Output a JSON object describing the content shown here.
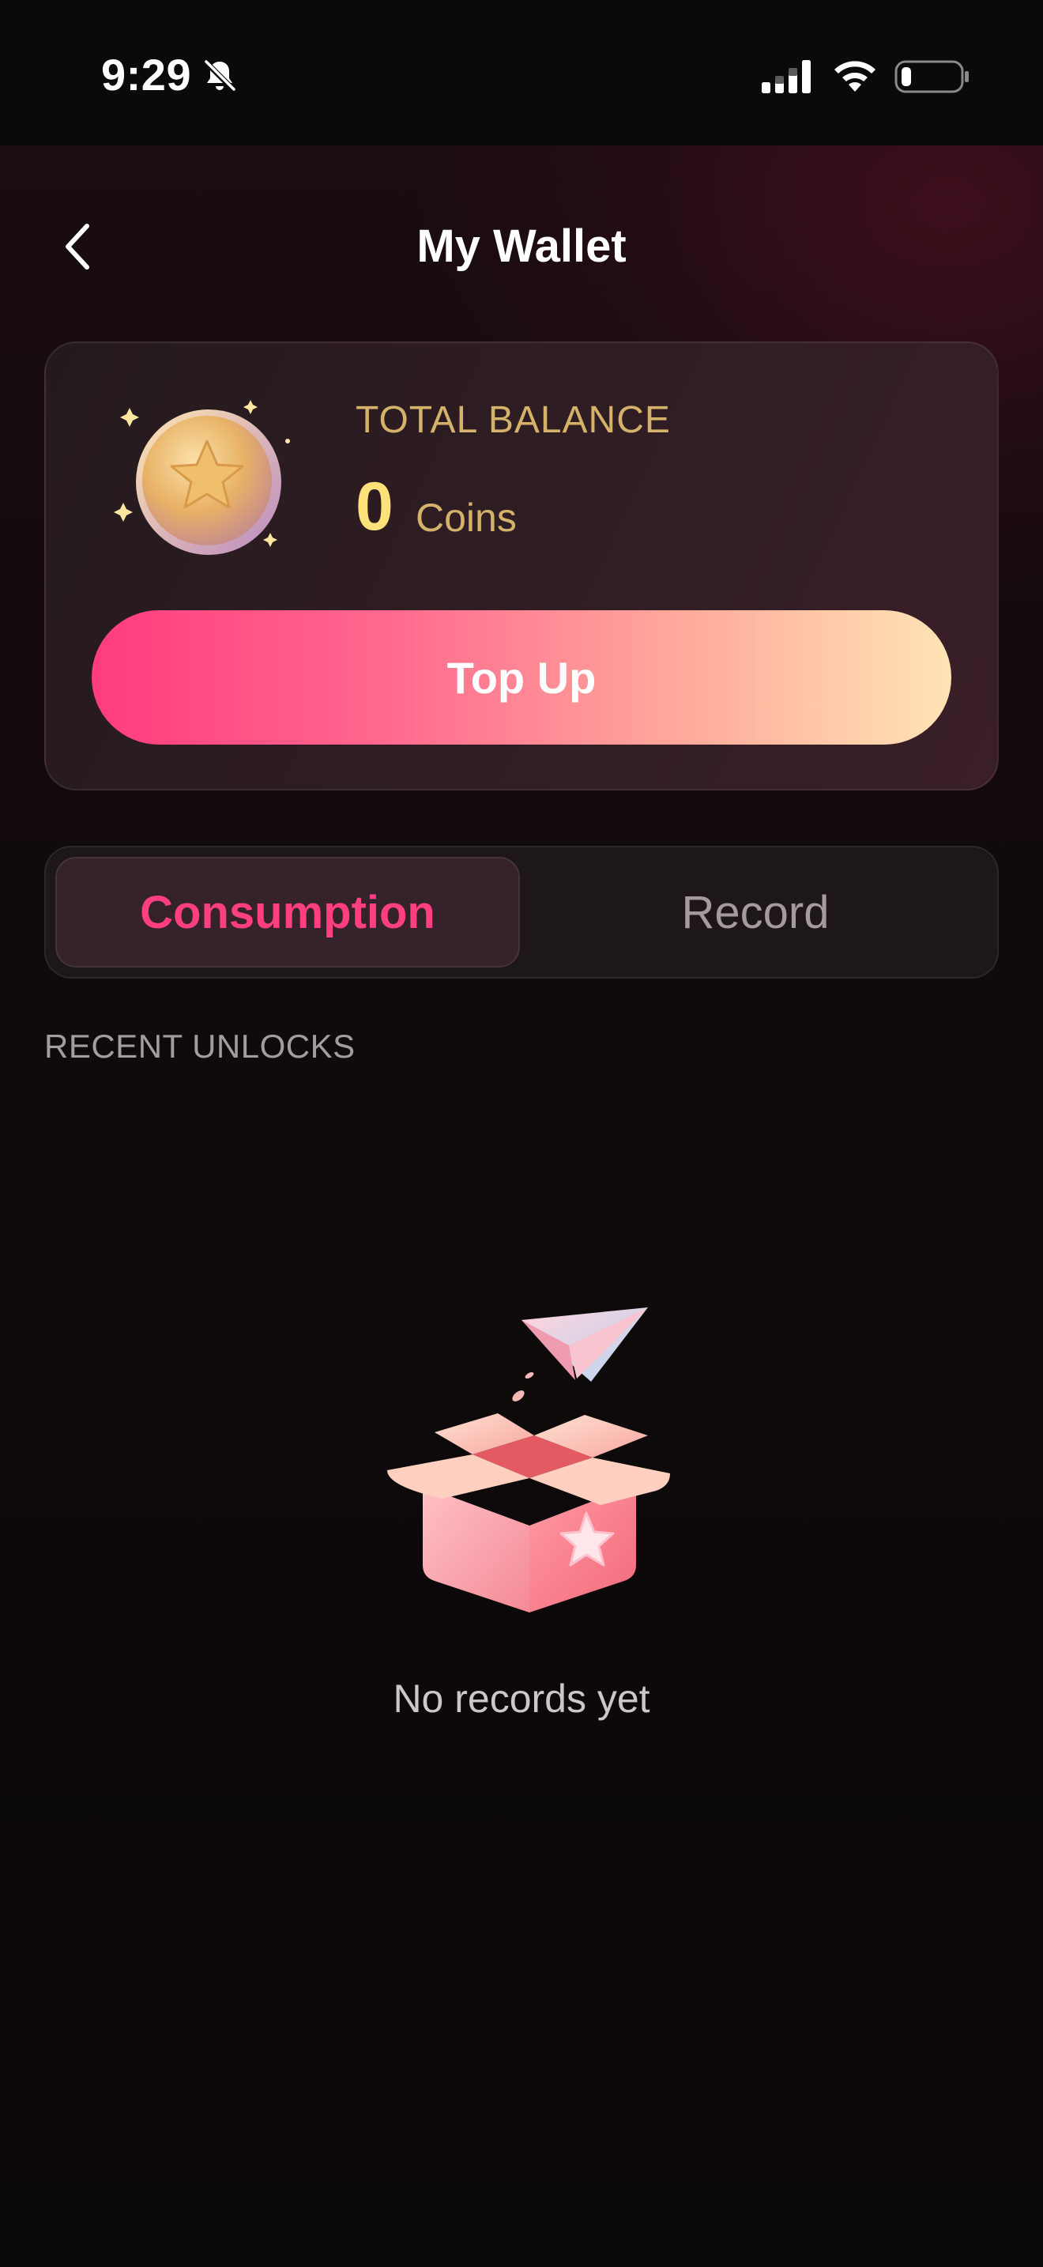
{
  "status_bar": {
    "time": "9:29",
    "icons": [
      "bell-slash-icon",
      "cellular-signal-icon",
      "wifi-icon",
      "battery-icon"
    ]
  },
  "header": {
    "title": "My Wallet",
    "back_icon": "chevron-left-icon"
  },
  "balance_card": {
    "coin_icon": "star-coin-icon",
    "label": "TOTAL BALANCE",
    "amount": "0",
    "unit": "Coins",
    "top_up_label": "Top Up"
  },
  "tabs": [
    {
      "label": "Consumption",
      "active": true
    },
    {
      "label": "Record",
      "active": false
    }
  ],
  "section": {
    "title": "RECENT UNLOCKS"
  },
  "empty_state": {
    "illustration_icon": "open-box-paper-plane-icon",
    "message": "No records yet"
  },
  "colors": {
    "accent": "#ff3f7f",
    "gold": "#d4b26a",
    "balance_value": "#ffe17a",
    "button_gradient_start": "#ff3c7e",
    "button_gradient_end": "#ffe4b5",
    "background": "#0f0a0b"
  }
}
